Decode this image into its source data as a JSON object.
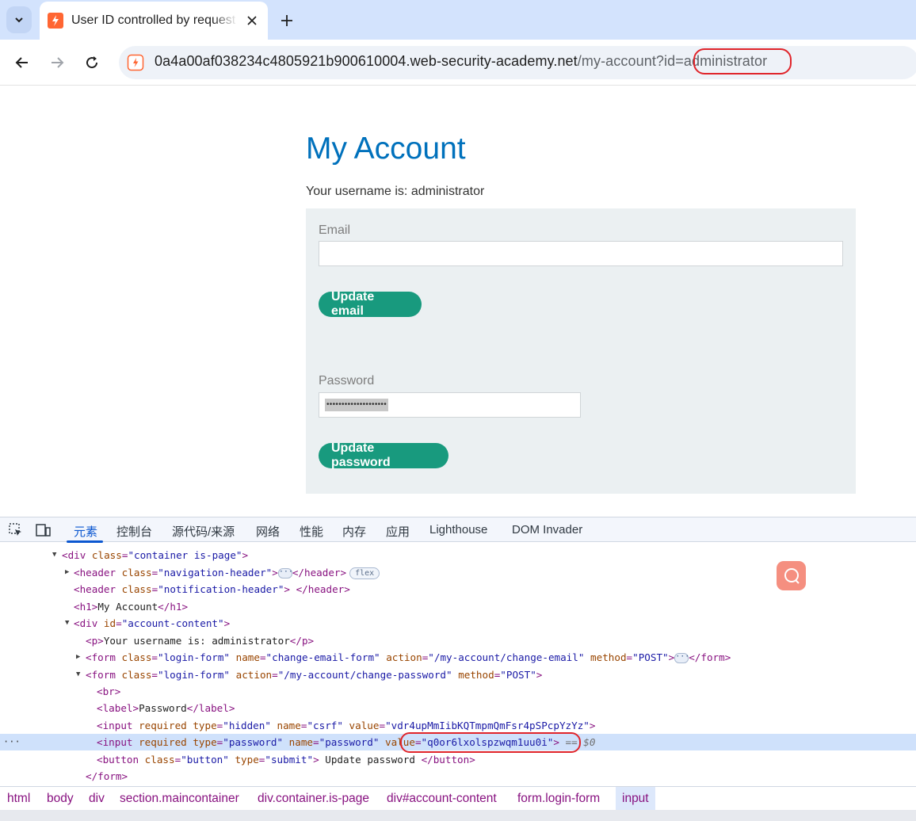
{
  "browser": {
    "tab_title": "User ID controlled by request",
    "url_host": "0a4a00af038234c4805921b900610004.web-security-academy.net",
    "url_path": "/my-account?id=administrator",
    "annotation_url_highlight": "administrator"
  },
  "page": {
    "title": "My Account",
    "username_text": "Your username is: administrator",
    "email_label": "Email",
    "email_value": "",
    "update_email_label": "Update email",
    "password_label": "Password",
    "password_mask": "••••••••••••••••••••",
    "update_password_label": "Update password"
  },
  "devtools": {
    "tabs": [
      "元素",
      "控制台",
      "源代码/来源",
      "网络",
      "性能",
      "内存",
      "应用",
      "Lighthouse",
      "DOM Invader"
    ],
    "active_tab": "元素",
    "dom_lines": {
      "container_open_tag": "div",
      "container_attr": "class",
      "container_val": "\"container is-page\"",
      "nav_header_attr_val": "\"navigation-header\"",
      "nav_header_badge": "flex",
      "notif_header_attr_val": "\"notification-header\"",
      "h1_text": "My Account",
      "account_div_val": "\"account-content\"",
      "p_text": "Your username is: administrator",
      "form1_class": "\"login-form\"",
      "form1_name": "\"change-email-form\"",
      "form1_action": "\"/my-account/change-email\"",
      "form1_method": "\"POST\"",
      "form2_class": "\"login-form\"",
      "form2_action": "\"/my-account/change-password\"",
      "form2_method": "\"POST\"",
      "label_text": "Password",
      "csrf_type": "\"hidden\"",
      "csrf_name": "\"csrf\"",
      "csrf_value": "\"vdr4upMmIibKQTmpmQmFsr4pSPcpYzYz\"",
      "pw_type": "\"password\"",
      "pw_name": "\"password\"",
      "pw_value": "\"q0or6lxolspzwqm1uu0i\"",
      "eq0": "== $0",
      "button_class": "\"button\"",
      "button_type": "\"submit\"",
      "button_text": " Update password "
    },
    "breadcrumbs": [
      "html",
      "body",
      "div",
      "section.maincontainer",
      "div.container.is-page",
      "div#account-content",
      "form.login-form",
      "input"
    ]
  },
  "colors": {
    "accent_blue": "#0071bc",
    "button_green": "#189a7e",
    "annotation_red": "#e0242a"
  }
}
